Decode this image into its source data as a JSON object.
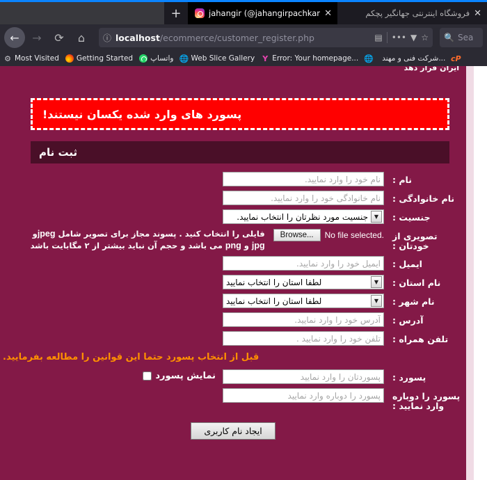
{
  "browser": {
    "tabs": [
      {
        "title": "فروشگاه اینترنتی جهانگیر پچکم",
        "active": false,
        "icon": "none",
        "close": "✕"
      },
      {
        "title": "jahangir (@jahangirpachkam) • In",
        "active": true,
        "icon": "instagram-icon",
        "close": "✕"
      }
    ],
    "new_tab_label": "+",
    "nav": {
      "back_label": "←",
      "forward_label": "→",
      "reload_label": "⟳",
      "home_label": "⌂"
    },
    "url": {
      "host": "localhost",
      "path": "/ecommerce/customer_register.php",
      "info_icon": "ⓘ",
      "reader_icon": "▤",
      "more_icon": "•••",
      "pocket_icon": "▼",
      "bookmark_icon": "☆"
    },
    "search": {
      "placeholder": "Sea",
      "icon": "🔍"
    },
    "bookmarks": [
      {
        "label": "Most Visited",
        "icon": "gear-icon"
      },
      {
        "label": "Getting Started",
        "icon": "firefox-icon"
      },
      {
        "label": "واتساپ",
        "icon": "whatsapp-icon"
      },
      {
        "label": "Web Slice Gallery",
        "icon": "globe-icon"
      },
      {
        "label": "Error: Your homepage...",
        "icon": "yahoo-icon"
      },
      {
        "label": "",
        "icon": "globe-icon"
      },
      {
        "label": "شرکت فنی و مهند...",
        "icon": "none"
      },
      {
        "label": "cP",
        "icon": "cpanel-icon"
      }
    ]
  },
  "page": {
    "top_clipped_text": "ایران قرار دهد",
    "alert_text": "پسورد های وارد شده یکسان نیستند!",
    "section_title": "ثبت نام",
    "fields": [
      {
        "label": "نام :",
        "type": "text",
        "placeholder": "نام خود را وارد نمایید.",
        "name": "first-name"
      },
      {
        "label": "نام خانوادگی :",
        "type": "text",
        "placeholder": "نام خانوادگی خود را وارد نمایید.",
        "name": "last-name"
      },
      {
        "label": "جنسیت :",
        "type": "select",
        "value": "جنسیت مورد نظرتان را انتخاب نمایید.",
        "name": "gender"
      },
      {
        "label": "تصویری از خودتان :",
        "type": "file",
        "name": "avatar"
      },
      {
        "label": "ایمیل :",
        "type": "text",
        "placeholder": "ایمیل خود را وارد نمایید.",
        "name": "email"
      },
      {
        "label": "نام استان :",
        "type": "select",
        "value": "لطفا استان را انتخاب نمایید",
        "name": "province"
      },
      {
        "label": "نام شهر :",
        "type": "select",
        "value": "لطفا استان را انتخاب نمایید",
        "name": "city"
      },
      {
        "label": "آدرس :",
        "type": "text",
        "placeholder": "آدرس خود را وارد نمایید.",
        "name": "address"
      },
      {
        "label": "تلفن همراه :",
        "type": "text",
        "placeholder": "تلفن خود را وارد نمایید .",
        "name": "mobile"
      },
      {
        "label": "پسورد :",
        "type": "password",
        "placeholder": "پسوردتان را وارد نمایید",
        "name": "password"
      },
      {
        "label": "پسورد را دوباره وارد نمایید :",
        "type": "password",
        "placeholder": "پسورد را دوباره وارد نمایید",
        "name": "password-confirm"
      }
    ],
    "file": {
      "browse_label": "Browse...",
      "no_file_text": "No file selected.",
      "help_line1_pre": "فایلی را انتخاب کنید . پسوند مجاز برای تصویر شامل ",
      "help_line1_lat": "jpeg",
      "help_line1_post": "و",
      "help_line2_lat1": "jpg",
      "help_line2_mid": " و ",
      "help_line2_lat2": "png",
      "help_line2_post": " می باشد و حجم آن نباید بیشتر از ۲ مگابایت باشد"
    },
    "rules_note": "قبل از انتخاب پسورد حتما این قوانین را مطالعه بفرمایید.",
    "show_password_label": "نمایش پسورد",
    "submit_label": "ایجاد نام کاربری"
  },
  "colors": {
    "page_bg": "#831947",
    "section_head": "#4a0f28",
    "alert_bg": "#ff0000",
    "note_orange": "#ff9000",
    "rail": "#f0dbe5"
  }
}
